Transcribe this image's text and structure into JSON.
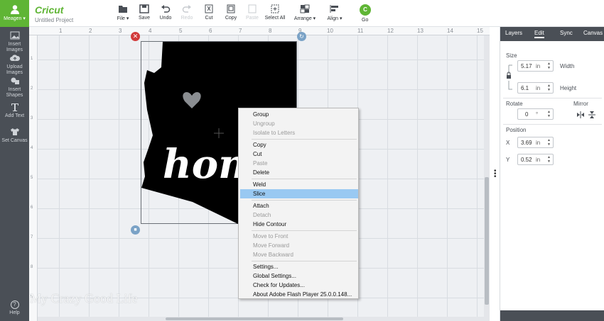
{
  "account": {
    "name": "Meagen ▾"
  },
  "rail": {
    "items": [
      {
        "label": "Insert Images",
        "icon": "image-icon"
      },
      {
        "label": "Upload Images",
        "icon": "cloud-upload-icon"
      },
      {
        "label": "Insert Shapes",
        "icon": "shapes-icon"
      },
      {
        "label": "Add Text",
        "icon": "text-icon"
      },
      {
        "label": "Set Canvas",
        "icon": "shirt-icon"
      }
    ],
    "help": "Help"
  },
  "header": {
    "logo": "Cricut",
    "project": "Untitled Project"
  },
  "toolbar": {
    "file": "File ▾",
    "save": "Save",
    "undo": "Undo",
    "redo": "Redo",
    "cut": "Cut",
    "copy": "Copy",
    "paste": "Paste",
    "select_all": "Select All",
    "arrange": "Arrange ▾",
    "align": "Align ▾",
    "go_icon": "C",
    "go": "Go"
  },
  "ruler": {
    "top": [
      "1",
      "2",
      "3",
      "4",
      "5",
      "6",
      "7",
      "8",
      "9",
      "10",
      "11",
      "12",
      "13",
      "14",
      "15"
    ],
    "left": [
      "1",
      "2",
      "3",
      "4",
      "5",
      "6",
      "7",
      "8",
      "9"
    ]
  },
  "design": {
    "text": "hom"
  },
  "watermark": "My Crazy Good Life",
  "context_menu": {
    "groups": [
      [
        {
          "label": "Group",
          "enabled": true
        },
        {
          "label": "Ungroup",
          "enabled": false
        },
        {
          "label": "Isolate to Letters",
          "enabled": false
        }
      ],
      [
        {
          "label": "Copy",
          "enabled": true
        },
        {
          "label": "Cut",
          "enabled": true
        },
        {
          "label": "Paste",
          "enabled": false
        },
        {
          "label": "Delete",
          "enabled": true
        }
      ],
      [
        {
          "label": "Weld",
          "enabled": true
        },
        {
          "label": "Slice",
          "enabled": true,
          "selected": true
        }
      ],
      [
        {
          "label": "Attach",
          "enabled": true
        },
        {
          "label": "Detach",
          "enabled": false
        },
        {
          "label": "Hide Contour",
          "enabled": true
        }
      ],
      [
        {
          "label": "Move to Front",
          "enabled": false
        },
        {
          "label": "Move Forward",
          "enabled": false
        },
        {
          "label": "Move Backward",
          "enabled": false
        }
      ],
      [
        {
          "label": "Settings...",
          "enabled": true
        },
        {
          "label": "Global Settings...",
          "enabled": true
        },
        {
          "label": "Check for Updates...",
          "enabled": true
        },
        {
          "label": "About Adobe Flash Player 25.0.0.148...",
          "enabled": true
        }
      ]
    ]
  },
  "panel": {
    "tabs": [
      "Layers",
      "Edit",
      "Sync",
      "Canvas"
    ],
    "active_tab": "Edit",
    "size_label": "Size",
    "width": {
      "value": "5.17",
      "unit": "in",
      "label": "Width"
    },
    "height": {
      "value": "6.1",
      "unit": "in",
      "label": "Height"
    },
    "rotate_label": "Rotate",
    "rotate": {
      "value": "0",
      "unit": "°"
    },
    "mirror_label": "Mirror",
    "position_label": "Position",
    "x": {
      "label": "X",
      "value": "3.69",
      "unit": "in"
    },
    "y": {
      "label": "Y",
      "value": "0.52",
      "unit": "in"
    }
  },
  "colors": {
    "brand": "#5fb535",
    "rail": "#4a4f56",
    "menu_highlight": "#99c9f2",
    "delete": "#d23b3b"
  }
}
